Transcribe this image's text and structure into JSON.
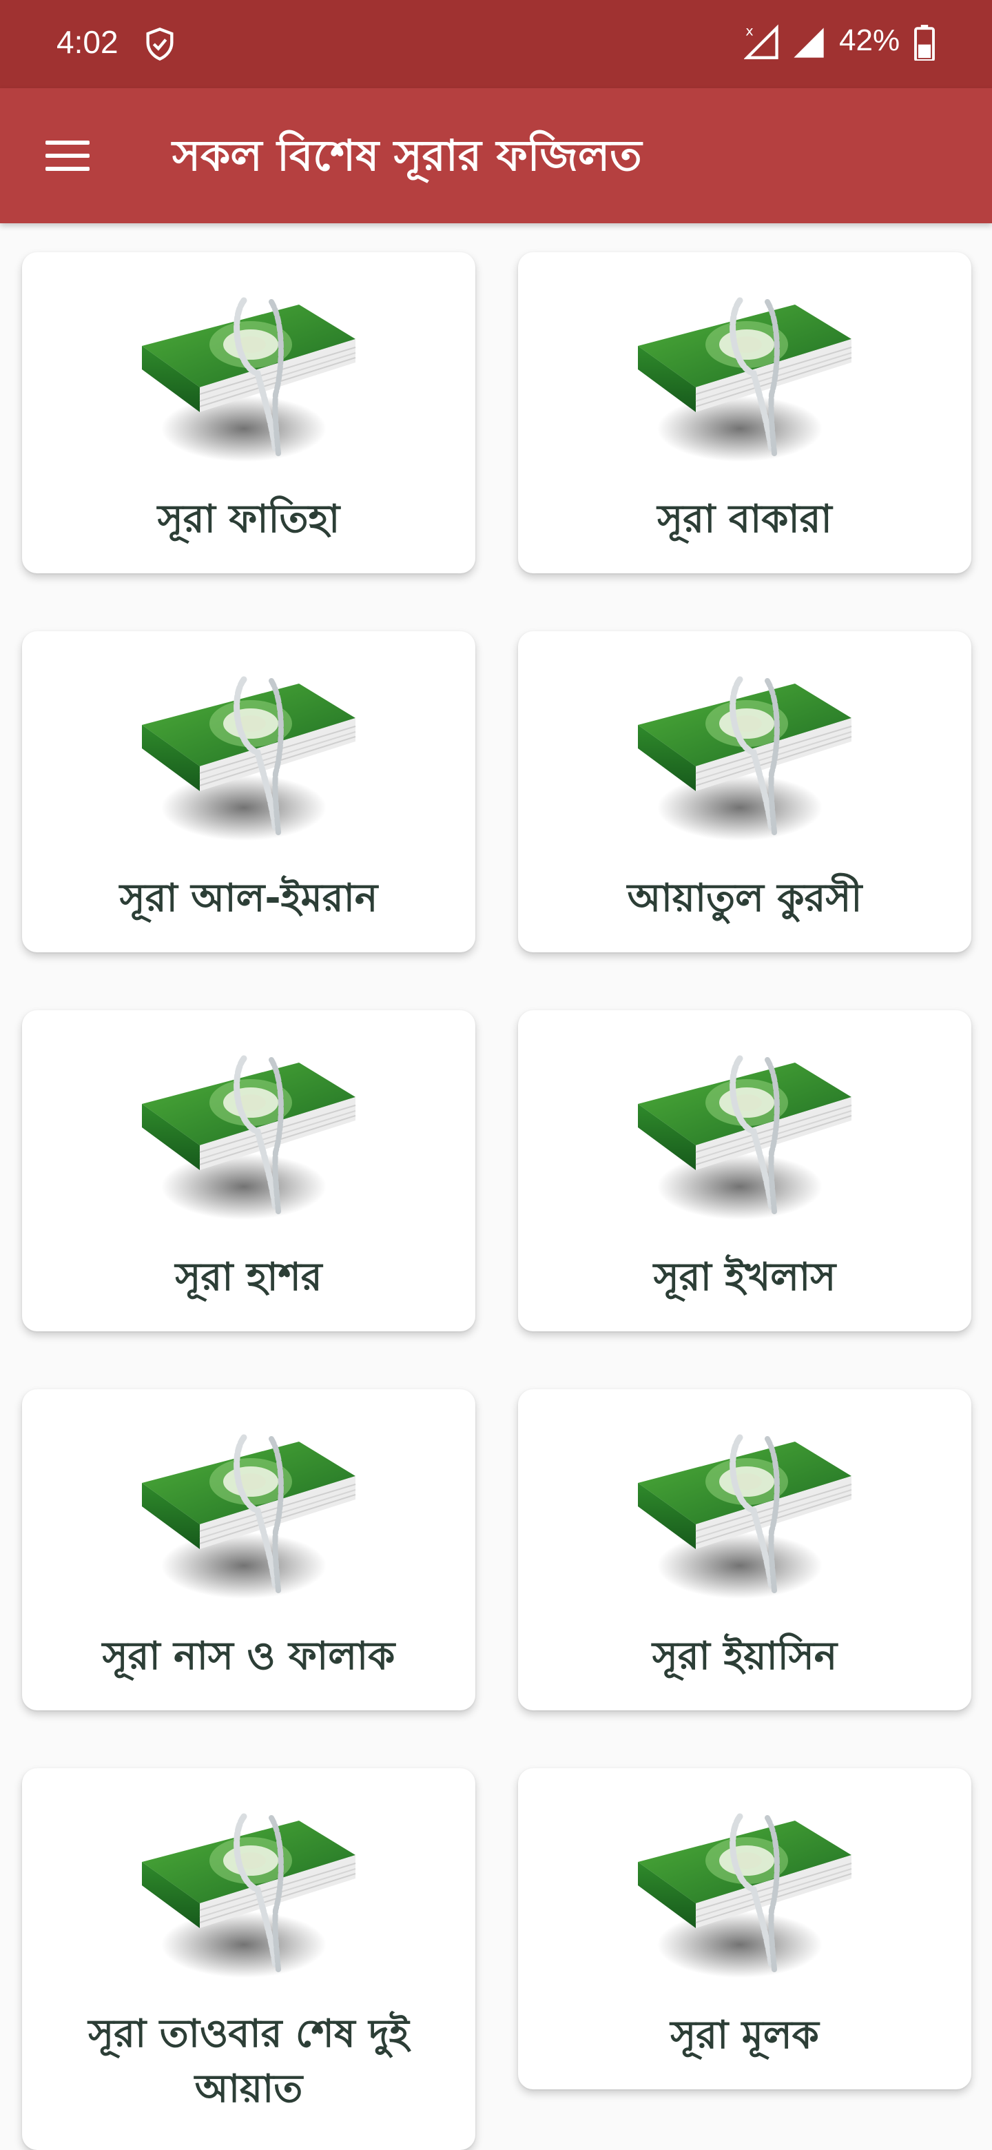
{
  "status_bar": {
    "time": "4:02",
    "battery_percent": "42%",
    "icons": [
      "shield-check-icon",
      "no-data-signal-icon",
      "signal-icon",
      "battery-icon"
    ]
  },
  "app_bar": {
    "title": "সকল বিশেষ সূরার ফজিলত",
    "menu_icon": "hamburger-menu-icon",
    "color": "#b54040"
  },
  "cards": [
    {
      "label": "সূরা ফাতিহা"
    },
    {
      "label": "সূরা বাকারা"
    },
    {
      "label": "সূরা আল-ইমরান"
    },
    {
      "label": "আয়াতুল কুরসী"
    },
    {
      "label": "সূরা হাশর"
    },
    {
      "label": "সূরা ইখলাস"
    },
    {
      "label": "সূরা নাস ও ফালাক"
    },
    {
      "label": "সূরা ইয়াসিন"
    },
    {
      "label": "সূরা তাওবার শেষ দুই আয়াত"
    },
    {
      "label": "সূরা মূলক"
    }
  ],
  "card_icon": "quran-book-icon",
  "colors": {
    "status_bar": "#a03231",
    "app_bar": "#b54040",
    "book_green": "#2e8b2e",
    "label_text": "#2c3e36"
  }
}
